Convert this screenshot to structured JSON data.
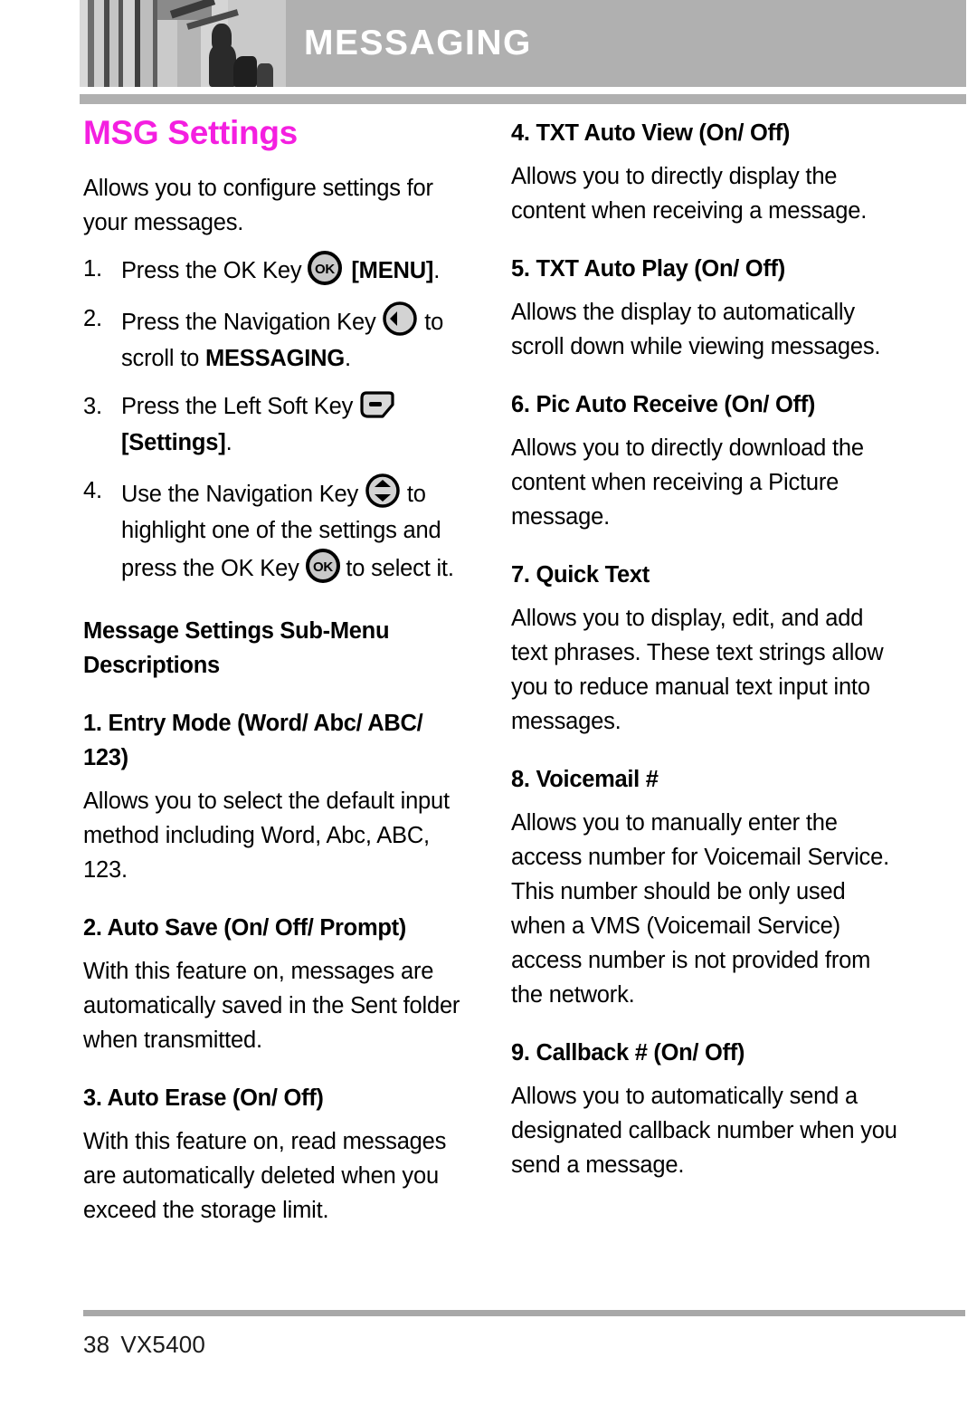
{
  "header": {
    "title": "MESSAGING",
    "photo_alt": "grayscale-photo-columns"
  },
  "left_column": {
    "page_title": "MSG Settings",
    "intro": "Allows you to configure settings for your messages.",
    "steps": [
      {
        "num": "1.",
        "before_icon": "Press the OK Key ",
        "icon": "ok-key-icon",
        "after_icon": " [MENU].",
        "after_bold": "[MENU]"
      },
      {
        "num": "2.",
        "before_icon": "Press the Navigation Key ",
        "icon": "nav-key-left-icon",
        "after_icon": " to scroll to ",
        "after_bold": "MESSAGING",
        "tail": "."
      },
      {
        "num": "3.",
        "before_icon": "Press the Left Soft Key ",
        "icon": "left-soft-key-icon",
        "after_bold": "[Settings]",
        "tail": "."
      },
      {
        "num": "4.",
        "before_icon": "Use the Navigation Key ",
        "icon": "nav-key-updown-icon",
        "after_icon": " to highlight one of the settings and press the OK Key ",
        "icon2": "ok-key-icon",
        "tail2": " to select it."
      }
    ],
    "subheading": "Message Settings Sub-Menu Descriptions",
    "sections": [
      {
        "heading": "1. Entry Mode (Word/ Abc/ ABC/ 123)",
        "body": "Allows you to select the default input method including Word, Abc, ABC, 123."
      },
      {
        "heading": "2. Auto Save (On/ Off/ Prompt)",
        "body": "With this feature on, messages are automatically saved in the Sent folder when transmitted."
      },
      {
        "heading": "3. Auto Erase (On/ Off)",
        "body": "With this feature on, read messages are automatically deleted when you exceed the storage limit."
      }
    ]
  },
  "right_column": {
    "sections": [
      {
        "heading": "4. TXT Auto View (On/ Off)",
        "body": "Allows you to directly display the content when receiving a message."
      },
      {
        "heading": "5. TXT Auto Play (On/ Off)",
        "body": "Allows the display to automatically scroll down while viewing messages."
      },
      {
        "heading": "6. Pic Auto Receive (On/ Off)",
        "body": "Allows you to directly download the content when receiving a Picture message."
      },
      {
        "heading": "7. Quick Text",
        "body": "Allows you to display, edit, and add text phrases. These text strings allow you to reduce manual text input into messages."
      },
      {
        "heading": "8. Voicemail #",
        "body": "Allows you to manually enter the access number for Voicemail Service. This number should be only used when a VMS (Voicemail Service) access number is not provided from the network."
      },
      {
        "heading": "9. Callback # (On/ Off)",
        "body": "Allows you to automatically send a designated callback number when you send a message."
      }
    ]
  },
  "footer": {
    "page_number": "38",
    "model": "VX5400"
  },
  "colors": {
    "title_magenta": "#f41fe0",
    "header_gray": "#b0b0b0",
    "rule_gray": "#a8a8a8"
  }
}
